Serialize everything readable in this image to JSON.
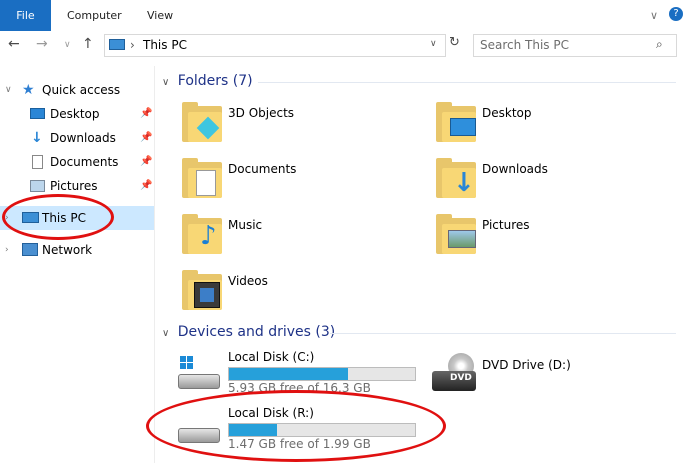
{
  "ribbon": {
    "file": "File",
    "computer": "Computer",
    "view": "View"
  },
  "address": {
    "path": "This PC",
    "separator": "›",
    "search_placeholder": "Search This PC"
  },
  "nav": {
    "quick_access": "Quick access",
    "items": [
      {
        "label": "Desktop"
      },
      {
        "label": "Downloads"
      },
      {
        "label": "Documents"
      },
      {
        "label": "Pictures"
      }
    ],
    "this_pc": "This PC",
    "network": "Network"
  },
  "folders": {
    "heading": "Folders (7)",
    "items": [
      "3D Objects",
      "Desktop",
      "Documents",
      "Downloads",
      "Music",
      "Pictures",
      "Videos"
    ]
  },
  "devices": {
    "heading": "Devices and drives (3)",
    "drives": [
      {
        "name": "Local Disk (C:)",
        "free": "5.93 GB free of 16.3 GB",
        "used_fraction": 0.64
      },
      {
        "name": "DVD Drive (D:)"
      },
      {
        "name": "Local Disk (R:)",
        "free": "1.47 GB free of 1.99 GB",
        "used_fraction": 0.26
      }
    ],
    "dvd_badge": "DVD"
  },
  "colors": {
    "accent": "#1a6ec2",
    "bar_fill": "#26a0da",
    "annotation": "#e01010",
    "selection": "#cce8ff"
  }
}
